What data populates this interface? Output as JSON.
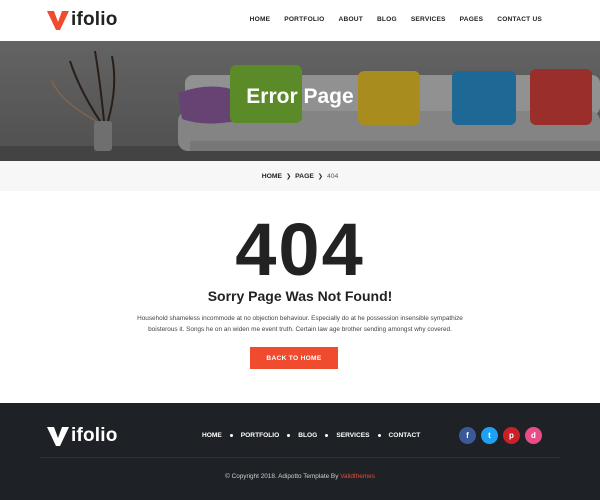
{
  "header": {
    "logo_text": "ifolio",
    "nav": [
      "HOME",
      "PORTFOLIO",
      "ABOUT",
      "BLOG",
      "SERVICES",
      "PAGES",
      "CONTACT US"
    ]
  },
  "hero": {
    "title": "Error Page"
  },
  "breadcrumb": {
    "home": "HOME",
    "page": "PAGE",
    "current": "404"
  },
  "main": {
    "code": "404",
    "title": "Sorry Page Was Not Found!",
    "description": "Household shameless incommode at no objection behaviour. Especially do at he possession insensible sympathize boisterous it. Songs he on an widen me event truth. Certain law age brother sending amongst why covered.",
    "button_label": "BACK TO HOME"
  },
  "footer": {
    "logo_text": "ifolio",
    "nav": [
      "HOME",
      "PORTFOLIO",
      "BLOG",
      "SERVICES",
      "CONTACT"
    ],
    "social": [
      {
        "icon": "facebook-icon",
        "glyph": "f",
        "color": "#3b5998"
      },
      {
        "icon": "twitter-icon",
        "glyph": "t",
        "color": "#1da1f2"
      },
      {
        "icon": "pinterest-icon",
        "glyph": "p",
        "color": "#cb2027"
      },
      {
        "icon": "dribbble-icon",
        "glyph": "d",
        "color": "#ea4c89"
      }
    ],
    "copyright_prefix": "© Copyright 2018. Adipotto Template By",
    "copyright_brand": "Validthemes"
  },
  "colors": {
    "accent": "#f04a2f",
    "footer_bg": "#1e2126"
  }
}
